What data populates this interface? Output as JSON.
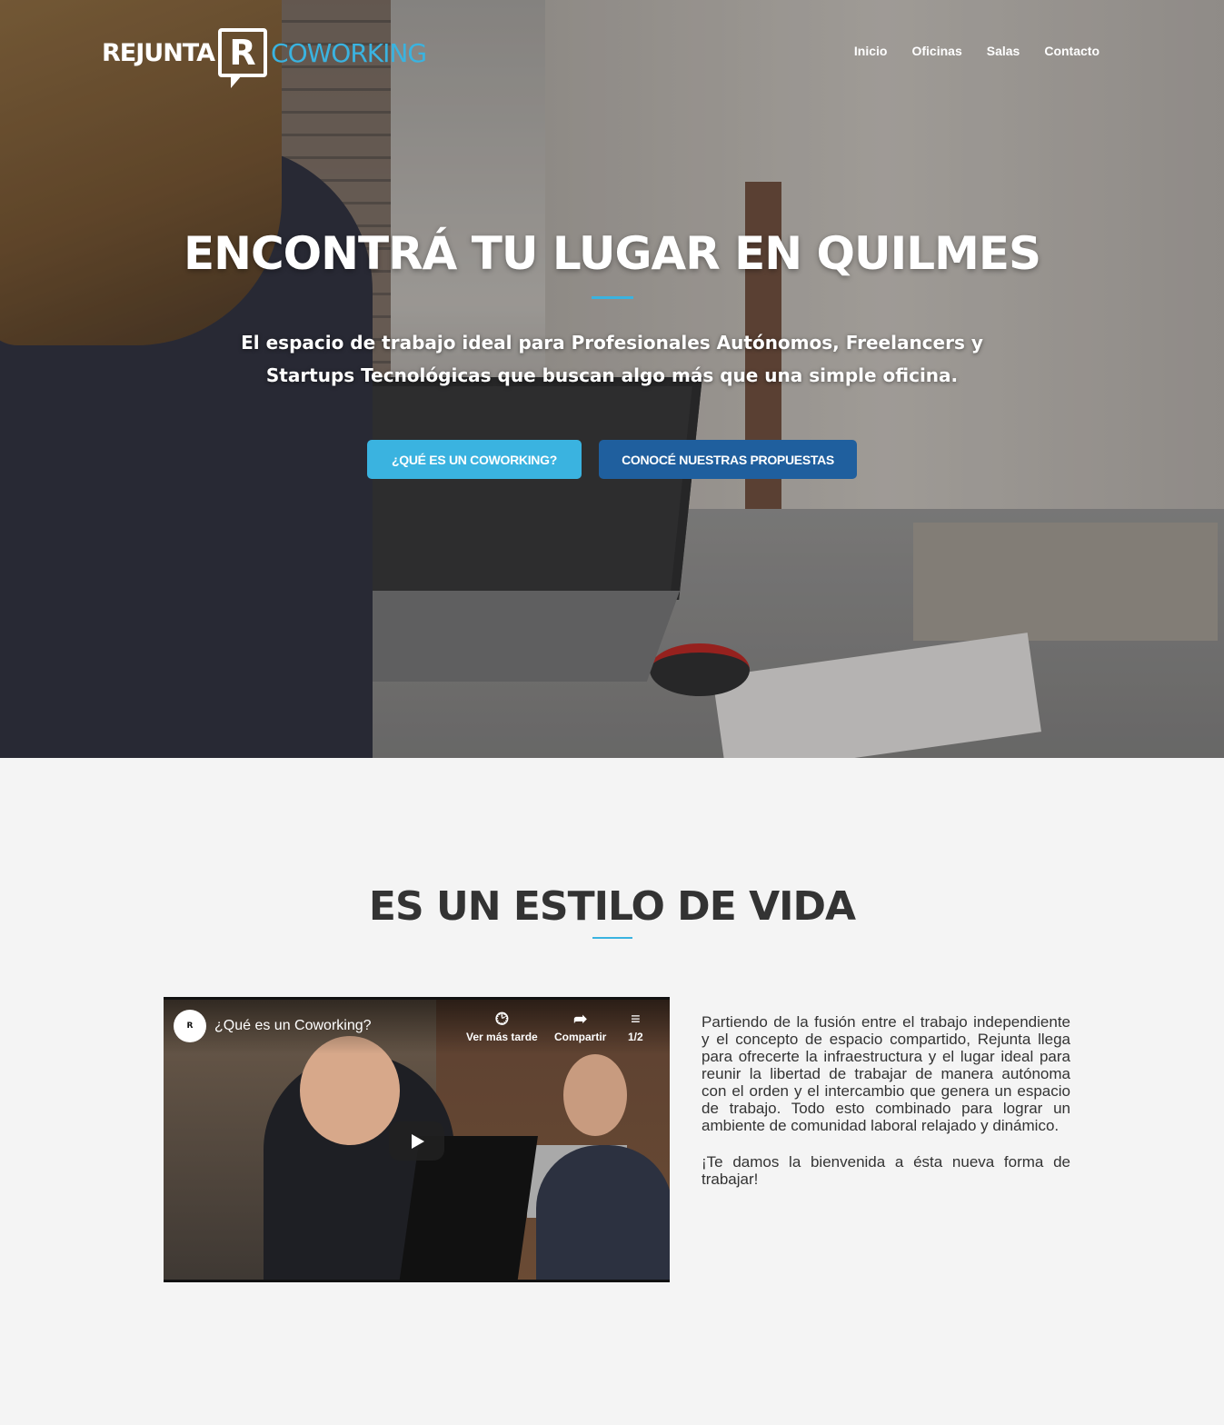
{
  "header": {
    "logo_left": "REJUNTA",
    "logo_mark": "R",
    "logo_right": "COWORKING",
    "nav": [
      "Inicio",
      "Oficinas",
      "Salas",
      "Contacto"
    ]
  },
  "hero": {
    "title": "ENCONTRÁ TU LUGAR EN QUILMES",
    "subtitle": "El espacio de trabajo ideal para Profesionales Autónomos, Freelancers y Startups Tecnológicas que buscan algo más que una simple oficina.",
    "button_primary": "¿QUÉ ES UN COWORKING?",
    "button_secondary": "CONOCÉ NUESTRAS PROPUESTAS"
  },
  "section": {
    "title": "ES UN ESTILO DE VIDA",
    "video": {
      "channel_badge": "R",
      "title": "¿Qué es un Coworking?",
      "watch_later": "Ver más tarde",
      "share": "Compartir",
      "playlist_count": "1/2"
    },
    "paragraph_1": "Partiendo de la fusión entre el trabajo independiente y el concepto de espacio compartido, Rejunta llega para ofrecerte la infraestructura y el lugar ideal para reunir la libertad de trabajar de manera autónoma con el orden y el intercambio que genera un espacio de trabajo. Todo esto combinado para lograr un ambiente de comunidad laboral relajado y dinámico.",
    "paragraph_2": "¡Te damos la bienvenida a ésta nueva forma de trabajar!"
  },
  "colors": {
    "accent": "#3ab3e0",
    "button_secondary": "#1f5f9e",
    "page_bg": "#f4f4f4"
  },
  "icons": [
    "clock-icon",
    "share-icon",
    "playlist-icon",
    "play-icon"
  ]
}
